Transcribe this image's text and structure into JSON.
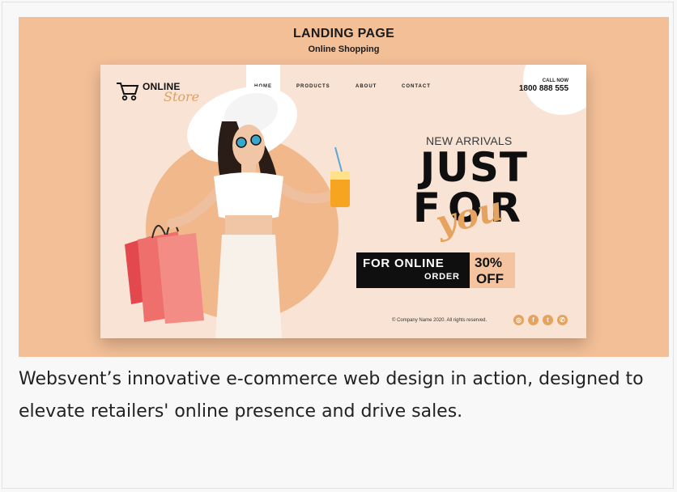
{
  "hero": {
    "title": "LANDING PAGE",
    "subtitle": "Online Shopping"
  },
  "mockup": {
    "logo": {
      "main_text": "ONLINE",
      "script_text": "Store",
      "icon": "shopping-cart-icon"
    },
    "nav": [
      "HOME",
      "PRODUCTS",
      "ABOUT",
      "CONTACT"
    ],
    "call": {
      "label": "CALL NOW",
      "number": "1800 888 555"
    },
    "headline": {
      "new_arrivals": "NEW ARRIVALS",
      "line1": "JUST",
      "line2": "FOR",
      "script": "you"
    },
    "offer": {
      "line1": "FOR ONLINE",
      "line2": "ORDER",
      "percent": "30%",
      "off": "OFF"
    },
    "footer": {
      "copyright": "© Company Name 2020. All rights reserved.",
      "social_icons": [
        "instagram-icon",
        "facebook-icon",
        "twitter-icon",
        "whatsapp-icon"
      ]
    },
    "colors": {
      "accent": "#e6a35f",
      "background": "#f8e3d4",
      "text": "#0f0f0f"
    }
  },
  "caption": "Websvent’s innovative e-commerce web design in action, designed to elevate retailers' online presence and drive sales."
}
